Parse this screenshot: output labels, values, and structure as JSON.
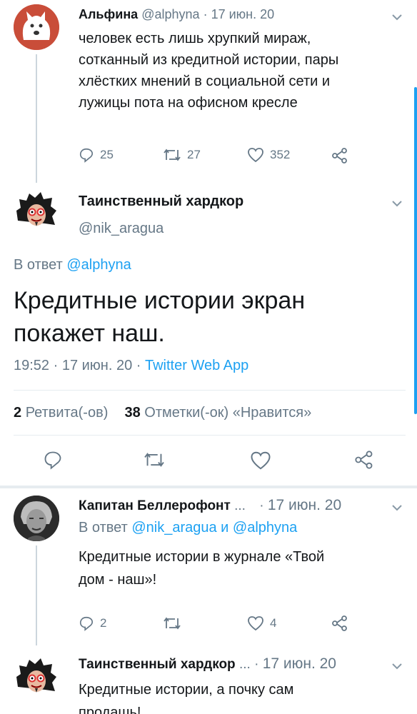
{
  "tweet1": {
    "name": "Альфина",
    "handle": "@alphyna",
    "sep": "·",
    "date": "17 июн. 20",
    "text_lines": [
      "человек есть лишь хрупкий мираж,",
      "сотканный из кредитной истории, пары",
      "хлёстких мнений в социальной сети и",
      "лужицы пота на офисном кресле"
    ],
    "replies": "25",
    "retweets": "27",
    "likes": "352"
  },
  "main": {
    "name": "Таинственный хардкор",
    "handle": "@nik_aragua",
    "reply_prefix": "В ответ",
    "reply_to": "@alphyna",
    "text_lines": [
      "Кредитные истории экран",
      "покажет наш."
    ],
    "time": "19:52 · 17 июн. 20 ·",
    "source": "Twitter Web App",
    "retweets_count": "2",
    "retweets_label": "Ретвита(-ов)",
    "likes_count": "38",
    "likes_label": "Отметки(-ок) «Нравится»"
  },
  "reply1": {
    "name": "Капитан Беллерофонт",
    "ellipsis": "...",
    "sep": "·",
    "date": "17 июн. 20",
    "reply_prefix": "В ответ",
    "reply_to_1": "@nik_aragua",
    "and": "и",
    "reply_to_2": "@alphyna",
    "text_lines": [
      "Кредитные истории в журнале «Твой",
      "дом - наш»!"
    ],
    "replies": "2",
    "likes": "4"
  },
  "reply2": {
    "name": "Таинственный хардкор",
    "ellipsis": "...",
    "sep": "·",
    "date": "17 июн. 20",
    "text_lines": [
      "Кредитные истории, а почку сам",
      "продашь!"
    ]
  },
  "colors": {
    "accent": "#1da1f2",
    "secondary_text": "#657786",
    "divider": "#e6ecf0"
  }
}
